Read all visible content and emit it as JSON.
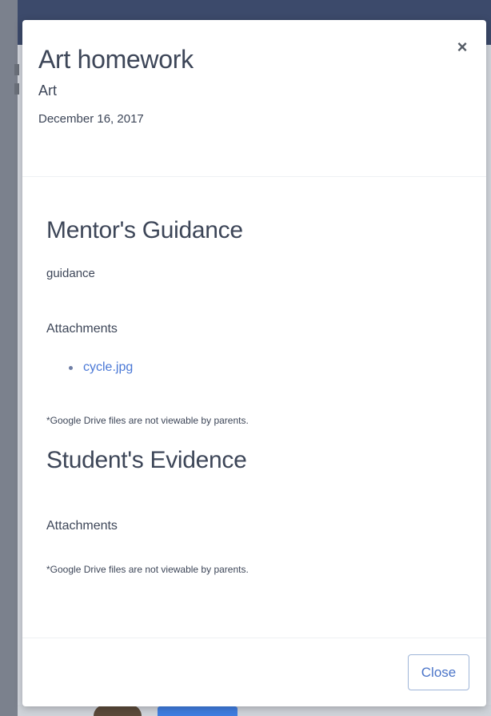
{
  "modal": {
    "title": "Art homework",
    "subject": "Art",
    "date": "December 16, 2017",
    "close_icon": "×",
    "guidance": {
      "heading": "Mentor's Guidance",
      "text": "guidance",
      "attachments_label": "Attachments",
      "attachments": [
        {
          "name": "cycle.jpg"
        }
      ],
      "drive_note": "*Google Drive files are not viewable by parents."
    },
    "evidence": {
      "heading": "Student's Evidence",
      "attachments_label": "Attachments",
      "drive_note": "*Google Drive files are not viewable by parents."
    },
    "footer": {
      "close_label": "Close"
    }
  },
  "colors": {
    "heading_text": "#3d4658",
    "link": "#4a78d6",
    "button_border": "#9fb5d8",
    "background_topbar": "#3c4a6b"
  }
}
